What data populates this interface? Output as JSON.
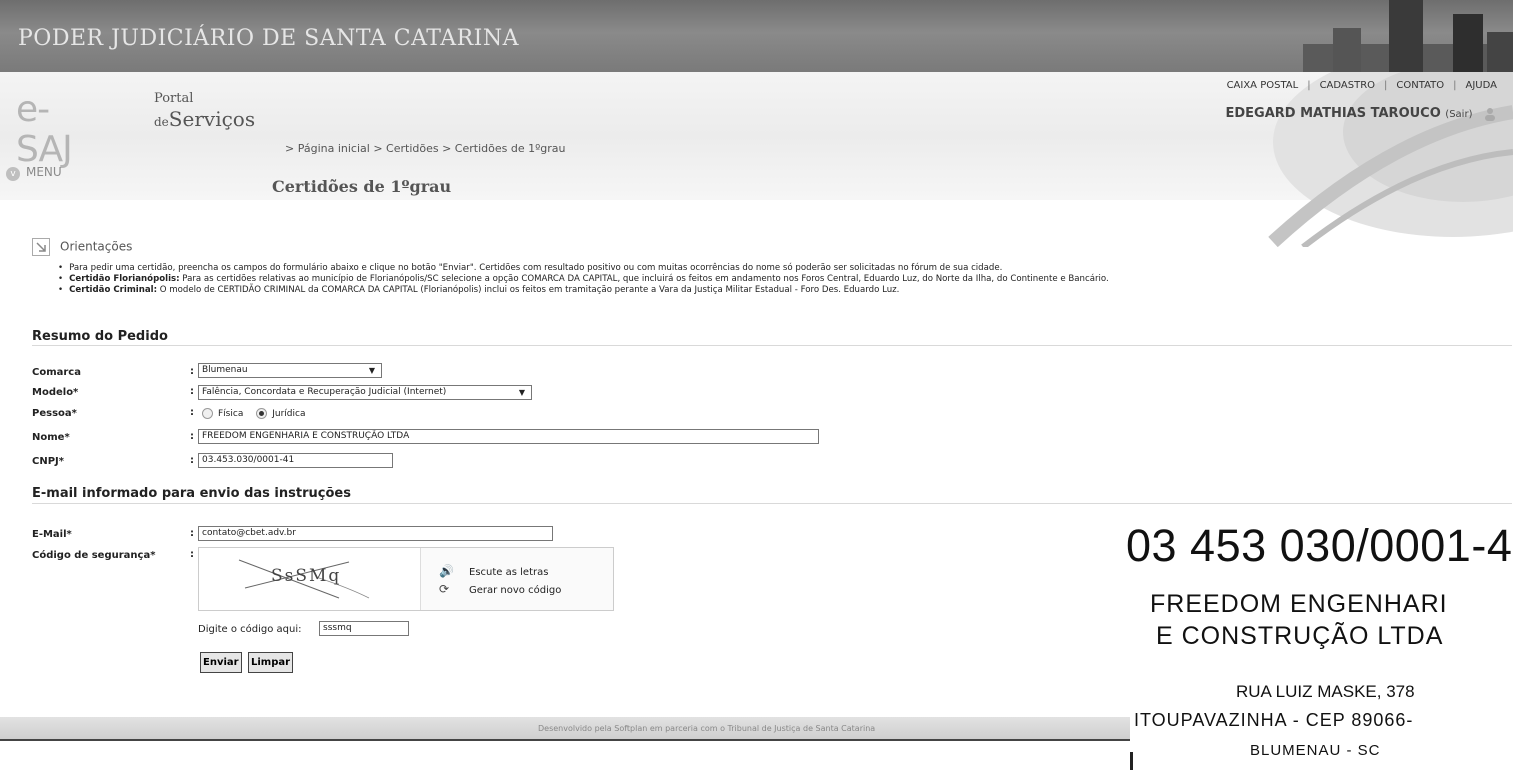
{
  "banner": {
    "title": "PODER JUDICIÁRIO DE SANTA CATARINA"
  },
  "header": {
    "logo_esaj": "e-SAJ",
    "logo_portal": "Portal",
    "logo_de": "de",
    "logo_servicos": "Serviços",
    "top_links": [
      "CAIXA POSTAL",
      "CADASTRO",
      "CONTATO",
      "AJUDA"
    ],
    "user_name": "EDEGARD MATHIAS TAROUCO",
    "sair": "(Sair)",
    "breadcrumb": "> Página inicial > Certidões > Certidões de 1ºgrau",
    "menu": "MENU",
    "page_title": "Certidões de 1ºgrau"
  },
  "orientacoes": {
    "title": "Orientações",
    "items": [
      {
        "bold": "",
        "text": "Para pedir uma certidão, preencha os campos do formulário abaixo e clique no botão \"Enviar\". Certidões com resultado positivo ou com muitas ocorrências do nome só poderão ser solicitadas no fórum de sua cidade."
      },
      {
        "bold": "Certidão Florianópolis:",
        "text": " Para as certidões relativas ao município de Florianópolis/SC selecione a opção COMARCA DA CAPITAL, que incluirá os feitos em andamento nos Foros Central, Eduardo Luz, do Norte da Ilha, do Continente e Bancário."
      },
      {
        "bold": "Certidão Criminal:",
        "text": " O modelo de CERTIDÃO CRIMINAL da COMARCA DA CAPITAL (Florianópolis) inclui os feitos em tramitação perante a Vara da Justiça Militar Estadual - Foro Des. Eduardo Luz."
      }
    ]
  },
  "resumo": {
    "title": "Resumo do Pedido",
    "comarca_label": "Comarca",
    "comarca_value": "Blumenau",
    "modelo_label": "Modelo*",
    "modelo_value": "Falência, Concordata e Recuperação Judicial (Internet)",
    "pessoa_label": "Pessoa*",
    "pessoa_fisica": "Física",
    "pessoa_juridica": "Jurídica",
    "pessoa_selected": "Jurídica",
    "nome_label": "Nome*",
    "nome_value": "FREEDOM ENGENHARIA E CONSTRUÇÃO LTDA",
    "cnpj_label": "CNPJ*",
    "cnpj_value": "03.453.030/0001-41",
    "colon": ":"
  },
  "email_section": {
    "title": "E-mail informado para envio das instruções",
    "email_label": "E-Mail*",
    "email_value": "contato@cbet.adv.br",
    "codigo_label": "Código de segurança*",
    "captcha_text": "SsSMq",
    "escute": "Escute as letras",
    "gerar": "Gerar novo código",
    "digite_label": "Digite o código aqui:",
    "digite_value": "sssmq",
    "enviar": "Enviar",
    "limpar": "Limpar"
  },
  "stamp": {
    "cnpj": "03 453 030/0001-4",
    "name_line1": "FREEDOM ENGENHARI",
    "name_line2": "E CONSTRUÇÃO LTDA",
    "rua": "RUA LUIZ MASKE, 378",
    "bairro": "ITOUPAVAZINHA - CEP 89066-",
    "cidade": "BLUMENAU - SC"
  },
  "footer": {
    "text": "Desenvolvido pela Softplan em parceria com o Tribunal de Justiça de Santa Catarina"
  }
}
